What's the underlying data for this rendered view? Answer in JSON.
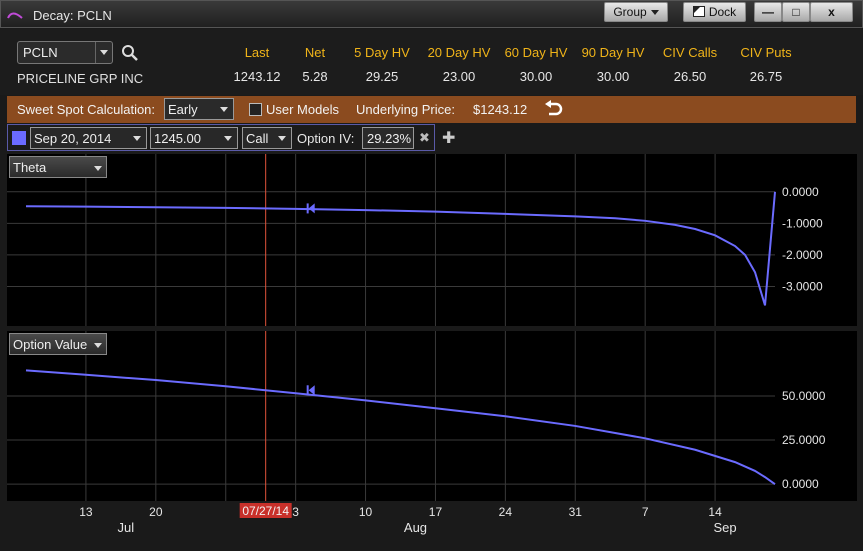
{
  "window": {
    "title": "Decay: PCLN",
    "group_label": "Group",
    "dock_label": "Dock",
    "minimize_label": "—",
    "maximize_label": "□",
    "close_label": "x"
  },
  "quote": {
    "symbol": "PCLN",
    "company": "PRICELINE GRP INC",
    "columns": [
      {
        "label": "Last",
        "value": "1243.12"
      },
      {
        "label": "Net",
        "value": "5.28"
      },
      {
        "label": "5 Day HV",
        "value": "29.25"
      },
      {
        "label": "20 Day HV",
        "value": "23.00"
      },
      {
        "label": "60 Day HV",
        "value": "30.00"
      },
      {
        "label": "90 Day HV",
        "value": "30.00"
      },
      {
        "label": "CIV Calls",
        "value": "26.50"
      },
      {
        "label": "CIV Puts",
        "value": "26.75"
      }
    ]
  },
  "sweet_spot": {
    "label": "Sweet Spot Calculation:",
    "mode": "Early",
    "user_models_label": "User Models",
    "user_models_checked": false,
    "underlying_label": "Underlying Price:",
    "underlying_price": "$1243.12"
  },
  "option": {
    "color": "#6b6bff",
    "expiry": "Sep 20, 2014",
    "strike": "1245.00",
    "type": "Call",
    "iv_label": "Option IV:",
    "iv_value": "29.23%"
  },
  "x_axis": {
    "day_labels": [
      "13",
      "20",
      "07/27/14",
      "3",
      "10",
      "17",
      "24",
      "31",
      "7",
      "14"
    ],
    "month_labels": [
      "Jul",
      "Aug",
      "Sep"
    ],
    "current_date": "07/27/14",
    "today_marker_date": "2014-07-31"
  },
  "chart_data": [
    {
      "type": "line",
      "title": "",
      "metric": "Theta",
      "x": [
        "2014-07-07",
        "2014-07-13",
        "2014-07-20",
        "2014-07-27",
        "2014-08-03",
        "2014-08-10",
        "2014-08-17",
        "2014-08-24",
        "2014-08-31",
        "2014-09-04",
        "2014-09-07",
        "2014-09-10",
        "2014-09-12",
        "2014-09-14",
        "2014-09-16",
        "2014-09-17",
        "2014-09-18",
        "2014-09-19",
        "2014-09-20"
      ],
      "series": [
        {
          "values": [
            -0.46,
            -0.47,
            -0.49,
            -0.51,
            -0.54,
            -0.58,
            -0.63,
            -0.7,
            -0.78,
            -0.84,
            -0.92,
            -1.05,
            -1.18,
            -1.38,
            -1.72,
            -2.0,
            -2.55,
            -3.6,
            0.0
          ]
        }
      ],
      "y_ticks": [
        "0.0000",
        "-1.0000",
        "-2.0000",
        "-3.0000"
      ],
      "ylim": [
        -4.0,
        0.5
      ],
      "color": "#6b6bff",
      "grid": true
    },
    {
      "type": "line",
      "title": "",
      "metric": "Option Value",
      "x": [
        "2014-07-07",
        "2014-07-13",
        "2014-07-20",
        "2014-07-27",
        "2014-08-03",
        "2014-08-10",
        "2014-08-17",
        "2014-08-24",
        "2014-08-31",
        "2014-09-07",
        "2014-09-12",
        "2014-09-16",
        "2014-09-18",
        "2014-09-19",
        "2014-09-20"
      ],
      "series": [
        {
          "values": [
            64.5,
            62.0,
            59.0,
            55.5,
            51.5,
            47.5,
            43.0,
            38.5,
            33.0,
            26.0,
            19.5,
            12.5,
            7.5,
            4.0,
            0.0
          ]
        }
      ],
      "y_ticks": [
        "50.0000",
        "25.0000",
        "0.0000"
      ],
      "ylim": [
        -5,
        80
      ],
      "color": "#6b6bff",
      "grid": true
    }
  ],
  "metric_selectors": {
    "top": "Theta",
    "bottom": "Option Value"
  }
}
